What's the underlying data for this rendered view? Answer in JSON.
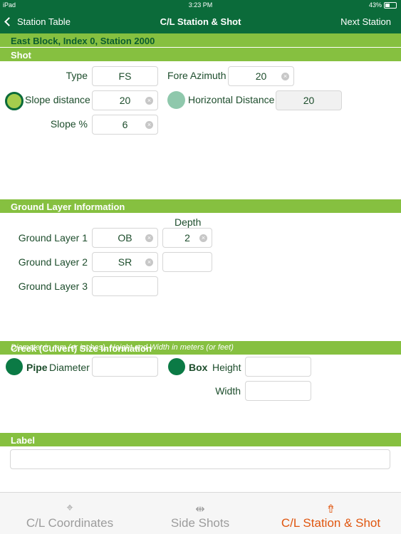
{
  "status_bar": {
    "device": "iPad",
    "time": "3:23 PM",
    "battery": "43%"
  },
  "nav": {
    "back_label": "Station Table",
    "title": "C/L Station & Shot",
    "next_label": "Next Station"
  },
  "location": "East Block, Index 0, Station 2000",
  "shot": {
    "header": "Shot",
    "type_label": "Type",
    "type_value": "FS",
    "fore_azimuth_label": "Fore Azimuth",
    "fore_azimuth_value": "20",
    "slope_distance_label": "Slope distance",
    "slope_distance_value": "20",
    "horizontal_distance_label": "Horizontal Distance",
    "horizontal_distance_value": "20",
    "slope_pct_label": "Slope %",
    "slope_pct_value": "6"
  },
  "ground": {
    "header": "Ground Layer Information",
    "depth_label": "Depth",
    "layers": [
      {
        "label": "Ground Layer 1",
        "value": "OB",
        "depth": "2"
      },
      {
        "label": "Ground Layer 2",
        "value": "SR",
        "depth": ""
      },
      {
        "label": "Ground Layer 3",
        "value": "",
        "depth": ""
      }
    ]
  },
  "creek": {
    "header": "Creek (Culvert) Size Information",
    "hint": "Diameter in mm (or inches), Height and Width in meters (or feet)",
    "pipe_label": "Pipe",
    "diameter_label": "Diameter",
    "diameter_value": "",
    "box_label": "Box",
    "height_label": "Height",
    "height_value": "",
    "width_label": "Width",
    "width_value": ""
  },
  "label_section": {
    "header": "Label",
    "value": ""
  },
  "tabs": [
    {
      "label": "C/L Coordinates",
      "icon": "crosshair-icon",
      "glyph": "⌖",
      "active": false
    },
    {
      "label": "Side Shots",
      "icon": "split-arrows-icon",
      "glyph": "⇹",
      "active": false
    },
    {
      "label": "C/L Station & Shot",
      "icon": "share-up-icon",
      "glyph": "⇮",
      "active": true
    }
  ],
  "colors": {
    "primary": "#0b6b3a",
    "accent": "#86c040",
    "active_tab": "#e0560f"
  }
}
